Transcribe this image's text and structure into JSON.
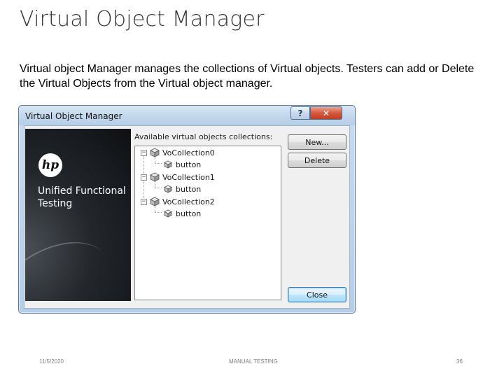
{
  "slide": {
    "title": "Virtual Object Manager",
    "body": "Virtual object Manager manages the collections of Virtual objects. Testers can add or Delete the Virtual Objects from the Virtual object manager."
  },
  "dialog": {
    "title": "Virtual Object Manager",
    "help_glyph": "?",
    "close_glyph": "✕",
    "banner": {
      "logo_text": "hp",
      "product_line1": "Unified Functional",
      "product_line2": "Testing"
    },
    "collections_label": "Available virtual objects collections:",
    "tree": [
      {
        "label": "VoCollection0",
        "expander": "−",
        "children": [
          "button"
        ]
      },
      {
        "label": "VoCollection1",
        "expander": "−",
        "children": [
          "button"
        ]
      },
      {
        "label": "VoCollection2",
        "expander": "−",
        "children": [
          "button"
        ]
      }
    ],
    "buttons": {
      "new": "New...",
      "delete": "Delete",
      "close": "Close"
    }
  },
  "footer": {
    "date": "11/5/2020",
    "center": "MANUAL TESTING",
    "page": "36"
  },
  "colors": {
    "titlebar": "#c3d7ec",
    "close_button": "#d45a40",
    "banner_bg": "#1a1d21"
  }
}
